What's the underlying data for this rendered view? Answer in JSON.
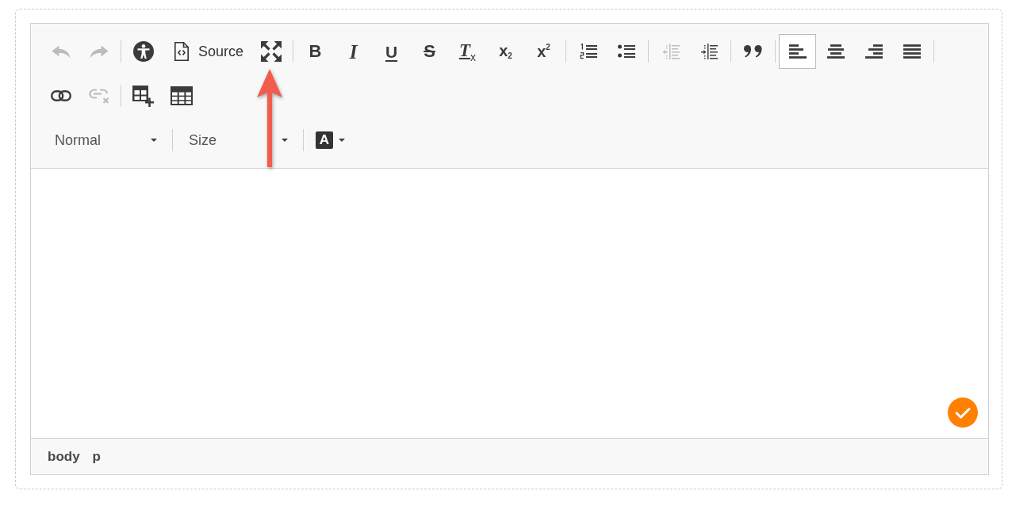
{
  "toolbar": {
    "rows": [
      {
        "end_separator": true,
        "groups": [
          {
            "buttons": [
              {
                "kind": "undo",
                "disabled": true
              },
              {
                "kind": "redo",
                "disabled": true
              }
            ]
          },
          {
            "buttons": [
              {
                "kind": "accessibility",
                "disabled": false
              },
              {
                "kind": "source",
                "label": "Source",
                "disabled": false
              },
              {
                "kind": "maximize",
                "disabled": false
              }
            ]
          },
          {
            "buttons": [
              {
                "kind": "bold",
                "glyph": "B",
                "disabled": false
              },
              {
                "kind": "italic",
                "glyph": "I",
                "disabled": false
              },
              {
                "kind": "underline",
                "glyph": "U",
                "disabled": false
              },
              {
                "kind": "strike",
                "glyph": "S",
                "disabled": false
              },
              {
                "kind": "removeformat",
                "glyph": "T$_{x}$",
                "disabled": false
              },
              {
                "kind": "subscript",
                "glyph": "x$_{2}$",
                "disabled": false
              },
              {
                "kind": "superscript",
                "glyph": "x$^{2}$",
                "disabled": false
              }
            ]
          },
          {
            "buttons": [
              {
                "kind": "numberedlist",
                "disabled": false
              },
              {
                "kind": "bulletedlist",
                "disabled": false
              }
            ]
          },
          {
            "buttons": [
              {
                "kind": "outdent",
                "disabled": true
              },
              {
                "kind": "indent",
                "disabled": false
              }
            ]
          },
          {
            "buttons": [
              {
                "kind": "blockquote",
                "disabled": false
              }
            ]
          },
          {
            "buttons": [
              {
                "kind": "alignleft",
                "selected": true,
                "disabled": false
              },
              {
                "kind": "aligncenter",
                "selected": false,
                "disabled": false
              },
              {
                "kind": "alignright",
                "selected": false,
                "disabled": false
              },
              {
                "kind": "justify",
                "selected": false,
                "disabled": false
              }
            ]
          }
        ]
      },
      {
        "end_separator": false,
        "groups": [
          {
            "buttons": [
              {
                "kind": "link",
                "disabled": false
              },
              {
                "kind": "unlink",
                "disabled": true
              }
            ]
          },
          {
            "buttons": [
              {
                "kind": "tableinsert",
                "disabled": false
              },
              {
                "kind": "table",
                "disabled": false
              }
            ]
          }
        ]
      },
      {
        "end_separator": false,
        "groups": [
          {
            "buttons": [
              {
                "kind": "format",
                "label": "Normal",
                "disabled": false
              }
            ]
          },
          {
            "buttons": [
              {
                "kind": "size",
                "label": "Size",
                "disabled": false
              }
            ]
          },
          {
            "buttons": [
              {
                "kind": "textcolor",
                "glyph": "A",
                "disabled": false
              }
            ]
          }
        ]
      }
    ]
  },
  "status_bar": {
    "path": [
      "body",
      "p"
    ]
  },
  "annotations": [
    {
      "kind": "arrow"
    }
  ]
}
